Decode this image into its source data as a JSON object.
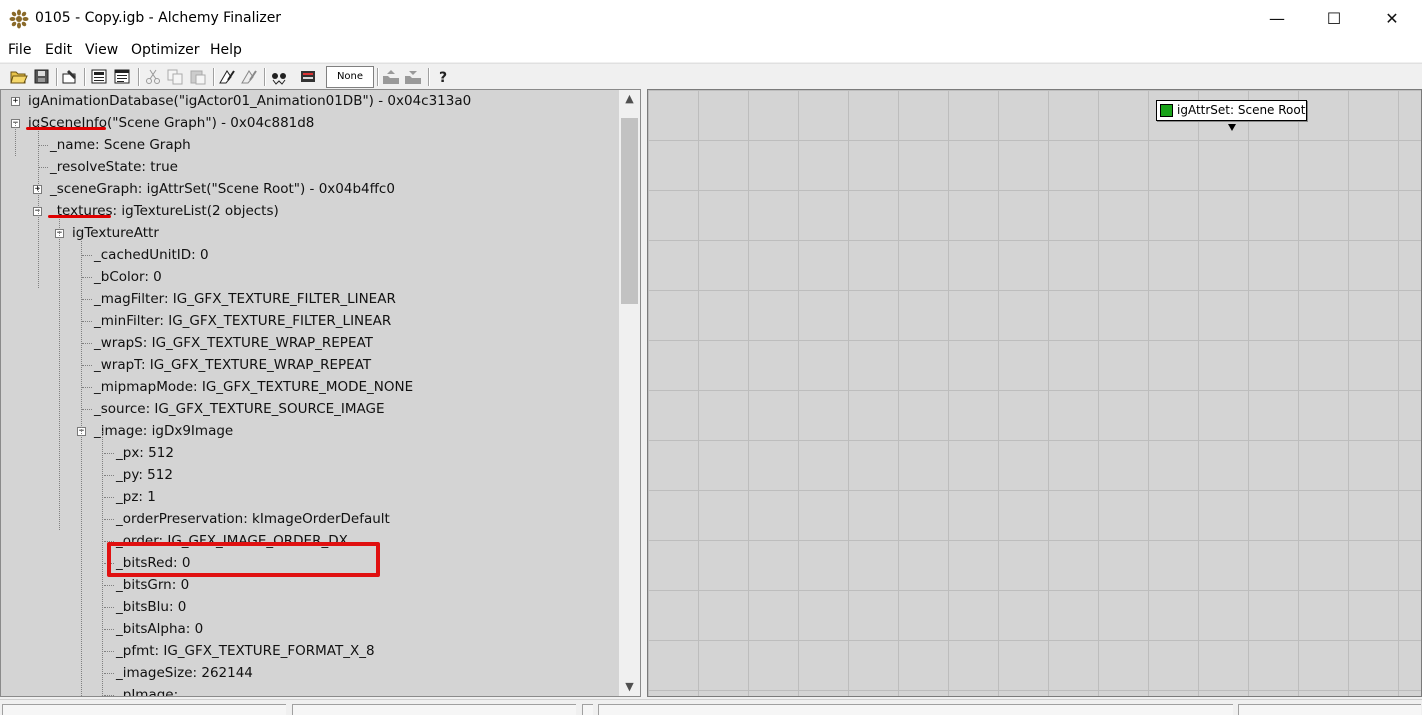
{
  "window": {
    "title": "0105 - Copy.igb - Alchemy Finalizer",
    "minimize": "—",
    "maximize": "☐",
    "close": "✕"
  },
  "menu": [
    "File",
    "Edit",
    "View",
    "Optimizer",
    "Help"
  ],
  "toolbar": {
    "dropdown_value": "None",
    "icons": [
      "open-icon",
      "save-icon",
      "properties-icon",
      "stats-icon",
      "report-icon",
      "cut-icon",
      "copy-icon",
      "paste-icon",
      "optimize-icon",
      "optimize-all-icon",
      "view-icon",
      "render-icon",
      "up-icon",
      "down-icon",
      "help-icon"
    ]
  },
  "tree": {
    "rows": [
      {
        "text": "igAnimationDatabase(\"igActor01_Animation01DB\") - 0x04c313a0",
        "expander": "+"
      },
      {
        "text": "igSceneInfo(\"Scene Graph\") - 0x04c881d8",
        "expander": "−"
      },
      {
        "text": "_name: Scene Graph",
        "expander": ""
      },
      {
        "text": "_resolveState: true",
        "expander": ""
      },
      {
        "text": "_sceneGraph: igAttrSet(\"Scene Root\") - 0x04b4ffc0",
        "expander": "+"
      },
      {
        "text": "_textures: igTextureList(2 objects)",
        "expander": "−"
      },
      {
        "text": "igTextureAttr",
        "expander": "−"
      },
      {
        "text": "_cachedUnitID: 0",
        "expander": ""
      },
      {
        "text": "_bColor: 0",
        "expander": ""
      },
      {
        "text": "_magFilter: IG_GFX_TEXTURE_FILTER_LINEAR",
        "expander": ""
      },
      {
        "text": "_minFilter: IG_GFX_TEXTURE_FILTER_LINEAR",
        "expander": ""
      },
      {
        "text": "_wrapS: IG_GFX_TEXTURE_WRAP_REPEAT",
        "expander": ""
      },
      {
        "text": "_wrapT: IG_GFX_TEXTURE_WRAP_REPEAT",
        "expander": ""
      },
      {
        "text": "_mipmapMode: IG_GFX_TEXTURE_MODE_NONE",
        "expander": ""
      },
      {
        "text": "_source: IG_GFX_TEXTURE_SOURCE_IMAGE",
        "expander": ""
      },
      {
        "text": "_image: igDx9Image",
        "expander": "−"
      },
      {
        "text": "_px: 512",
        "expander": ""
      },
      {
        "text": "_py: 512",
        "expander": ""
      },
      {
        "text": "_pz: 1",
        "expander": ""
      },
      {
        "text": "_orderPreservation: kImageOrderDefault",
        "expander": ""
      },
      {
        "text": "_order: IG_GFX_IMAGE_ORDER_DX",
        "expander": ""
      },
      {
        "text": "_bitsRed: 0",
        "expander": ""
      },
      {
        "text": "_bitsGrn: 0",
        "expander": ""
      },
      {
        "text": "_bitsBlu: 0",
        "expander": ""
      },
      {
        "text": "_bitsAlpha: 0",
        "expander": ""
      },
      {
        "text": "_pfmt: IG_GFX_TEXTURE_FORMAT_X_8",
        "expander": ""
      },
      {
        "text": "_imageSize: 262144",
        "expander": ""
      },
      {
        "text": "_pImage:",
        "expander": ""
      }
    ]
  },
  "graph": {
    "node_label": "igAttrSet: Scene Root"
  },
  "colors": {
    "highlight": "#e00000",
    "panel_bg": "#d4d4d4"
  }
}
